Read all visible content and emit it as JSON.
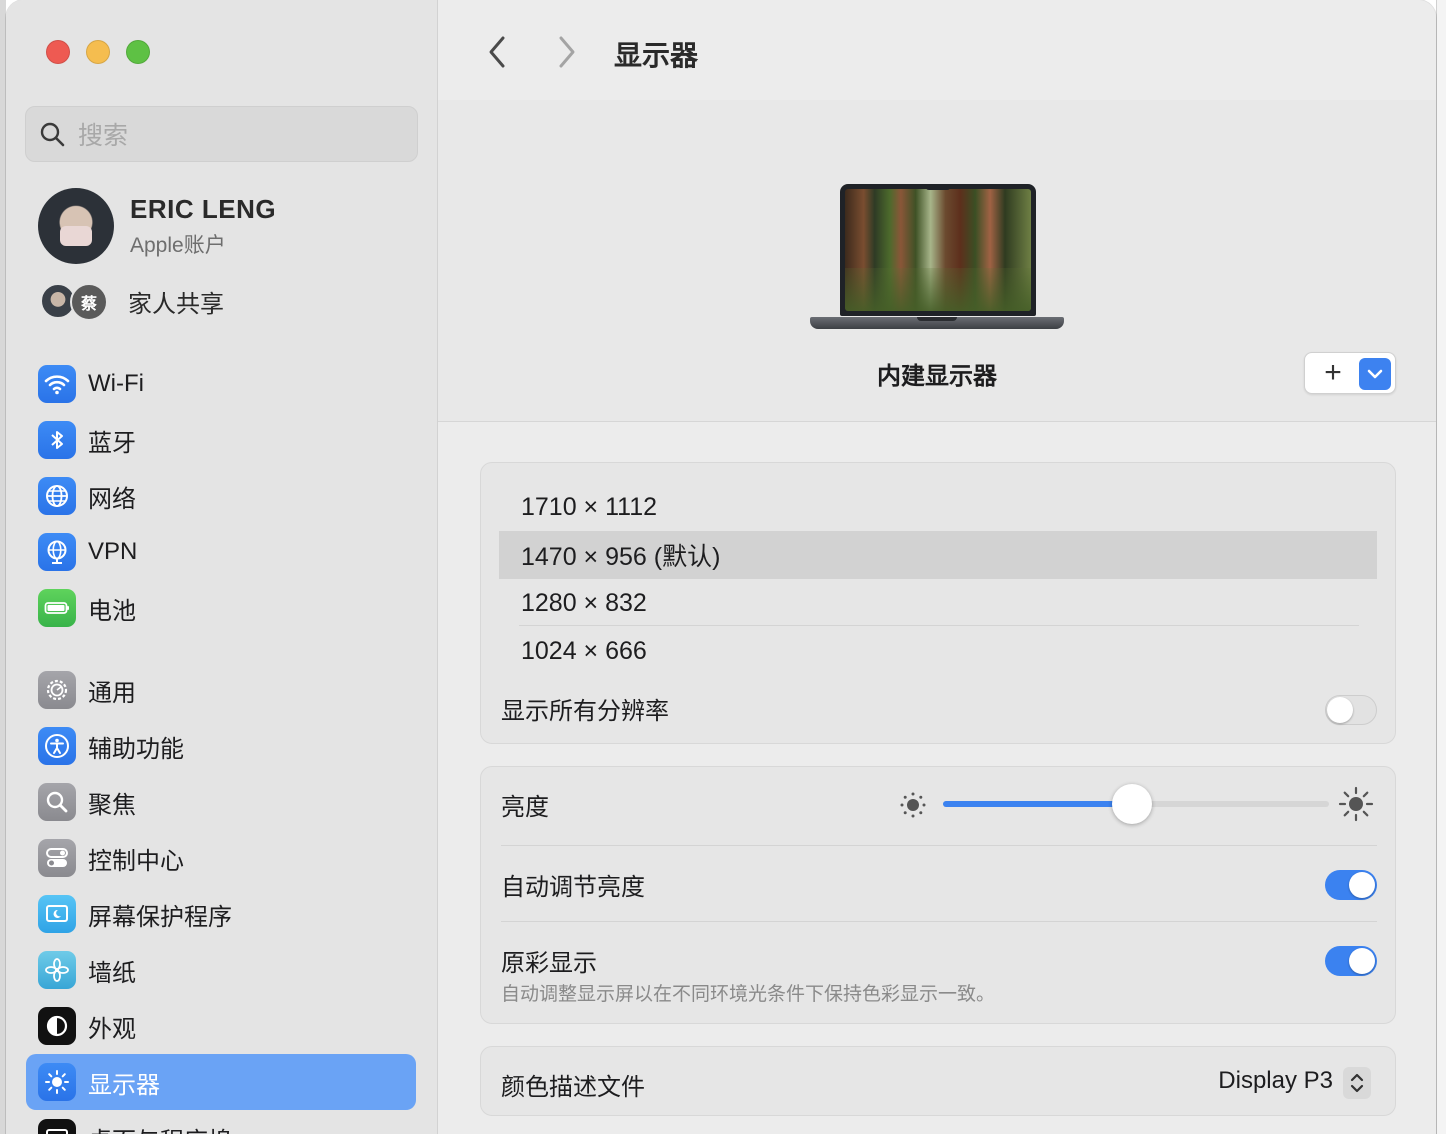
{
  "window": {
    "traffic_lights": [
      "close",
      "minimize",
      "zoom"
    ]
  },
  "sidebar": {
    "search_placeholder": "搜索",
    "account": {
      "name": "ERIC LENG",
      "subtitle": "Apple账户"
    },
    "family": {
      "label": "家人共享",
      "member_initial": "蔡"
    },
    "items": [
      {
        "label": "Wi-Fi",
        "icon": "wifi-icon"
      },
      {
        "label": "蓝牙",
        "icon": "bluetooth-icon"
      },
      {
        "label": "网络",
        "icon": "globe-icon"
      },
      {
        "label": "VPN",
        "icon": "vpn-globe-icon"
      },
      {
        "label": "电池",
        "icon": "battery-icon"
      },
      {
        "label": "通用",
        "icon": "gear-icon"
      },
      {
        "label": "辅助功能",
        "icon": "accessibility-icon"
      },
      {
        "label": "聚焦",
        "icon": "magnifier-icon"
      },
      {
        "label": "控制中心",
        "icon": "control-center-icon"
      },
      {
        "label": "屏幕保护程序",
        "icon": "screensaver-icon"
      },
      {
        "label": "墙纸",
        "icon": "wallpaper-flower-icon"
      },
      {
        "label": "外观",
        "icon": "appearance-icon"
      },
      {
        "label": "显示器",
        "icon": "sun-icon",
        "selected": true
      },
      {
        "label": "桌面与程序坞",
        "icon": "dock-icon"
      }
    ]
  },
  "main": {
    "title": "显示器",
    "display_name": "内建显示器",
    "add_button": "+",
    "resolutions": [
      {
        "label": "1710 × 1112",
        "selected": false
      },
      {
        "label": "1470 × 956 (默认)",
        "selected": true
      },
      {
        "label": "1280 × 832",
        "selected": false
      },
      {
        "label": "1024 × 666",
        "selected": false
      }
    ],
    "show_all_label": "显示所有分辨率",
    "show_all_on": false,
    "brightness_label": "亮度",
    "brightness_level": 0.49,
    "auto_brightness_label": "自动调节亮度",
    "auto_brightness_on": true,
    "true_tone_label": "原彩显示",
    "true_tone_desc": "自动调整显示屏以在不同环境光条件下保持色彩显示一致。",
    "true_tone_on": true,
    "color_profile_label": "颜色描述文件",
    "color_profile_value": "Display P3"
  },
  "colors": {
    "accent": "#3b82f0",
    "sidebar_selected": "#6aa3f5"
  }
}
